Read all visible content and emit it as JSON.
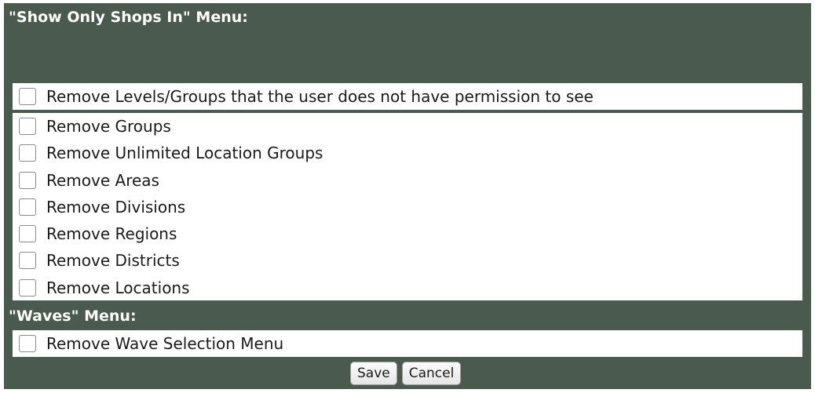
{
  "shops_menu": {
    "title": "\"Show Only Shops In\" Menu:",
    "permission_option": "Remove Levels/Groups that the user does not have permission to see",
    "level_options": [
      "Remove Groups",
      "Remove Unlimited Location Groups",
      "Remove Areas",
      "Remove Divisions",
      "Remove Regions",
      "Remove Districts",
      "Remove Locations"
    ]
  },
  "waves_menu": {
    "title": "\"Waves\" Menu:",
    "option": "Remove Wave Selection Menu"
  },
  "buttons": {
    "save_label": "Save",
    "cancel_label": "Cancel"
  }
}
